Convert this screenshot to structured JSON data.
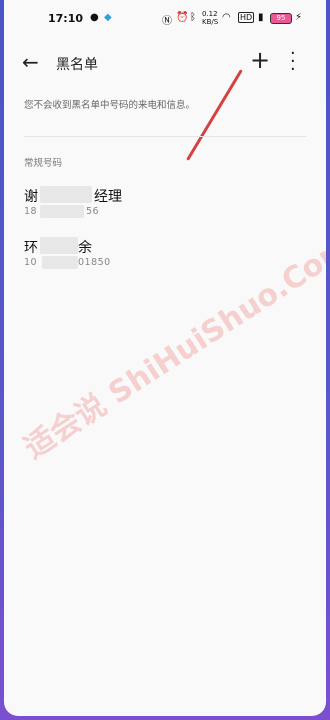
{
  "status_bar": {
    "time": "17:10",
    "net_speed": "0.12",
    "net_unit": "KB/S",
    "battery": "95"
  },
  "header": {
    "back_icon": "arrow-left-icon",
    "title": "黑名单",
    "add_icon": "plus-icon",
    "more_icon": "more-vertical-icon"
  },
  "description": "您不会收到黑名单中号码的来电和信息。",
  "section_title": "常规号码",
  "contacts": [
    {
      "name_prefix": "谢",
      "name_suffix": "经理",
      "number_prefix": "18",
      "number_suffix": "56"
    },
    {
      "name_prefix": "环",
      "name_suffix": "余",
      "number_prefix": "10",
      "number_suffix": "01850"
    }
  ],
  "watermark": "适会说 ShiHuiShuo.Com"
}
